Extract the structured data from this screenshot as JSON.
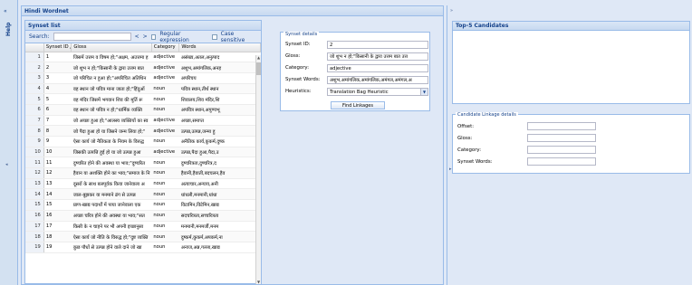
{
  "left_strip": {
    "collapse_symbol": "«",
    "help_label": "Help",
    "expand_symbol": "◂"
  },
  "main": {
    "title": "Hindi Wordnet",
    "synset_list": {
      "title": "Synset list",
      "search_label": "Search:",
      "search_value": "",
      "nav_prev": "<",
      "nav_next": ">",
      "regex_label": "Regular expression",
      "case_label": "Case sensitive",
      "columns": [
        "",
        "Synset ID ▲",
        "Gloss",
        "Category",
        "Words"
      ],
      "rows": [
        [
          "1",
          "1",
          "जिसमें उत्तम व विषम हो;\"अक्षम, अउत्तमा ह",
          "adjective",
          "असंख्य,अतल,अनुत्पाद"
        ],
        [
          "2",
          "2",
          "जो शुभ न हो;\"किसानी के द्वारा उत्तम बात",
          "adjective",
          "अशुभ,अमांगलिक,अनह"
        ],
        [
          "3",
          "3",
          "जो परिचित न हुआ हो;\"अपरिचित अतिथिन",
          "adjective",
          "अपरिचय"
        ],
        [
          "4",
          "4",
          "वह स्थान जो पवित्र माना जाता हो;\"हिंदुओं",
          "noun",
          "पवित्र स्थान,तीर्थ स्थान"
        ],
        [
          "5",
          "5",
          "वह मंदिर जिसमें भगवान शिव की मूर्ति रू",
          "noun",
          "शिवालय,शिव मंदिर,शि"
        ],
        [
          "6",
          "6",
          "वह स्थान जो पवित्र न हो;\"धार्मिक व्यक्ति",
          "noun",
          "अपवित्र स्थान,अपुण्यभू"
        ],
        [
          "7",
          "7",
          "जो अच्छा हुआ हो;\"आलस्य व्यक्तियों का स्व",
          "adjective",
          "अच्छा,समाप्त"
        ],
        [
          "8",
          "8",
          "जो पैदा हुआ हो या जिसने जन्म लिया हो;\"",
          "adjective",
          "उत्पन्न,उत्पन्न,जन्मा हु"
        ],
        [
          "9",
          "9",
          "ऐसा कार्य जो नैतिकता के नियम के विरुद्ध",
          "noun",
          "अनैतिक कार्य,कुकर्म,दुष्क"
        ],
        [
          "10",
          "10",
          "जिसकी उत्पत्ति हुई हो या जो उत्पन्न हुआ",
          "adjective",
          "उत्पन्न,पैदा हुआ,पैदा,उ"
        ],
        [
          "11",
          "11",
          "दुष्चरित होने की अवस्था या भाव;\"दुष्चरित",
          "noun",
          "दुष्चरित्रता,दुष्चरित्र,द"
        ],
        [
          "12",
          "12",
          "हैवान या अशक्ति होने का भाव;\"समाज के नि",
          "noun",
          "हैवानी,हैवाती,बदचलन,हैव"
        ],
        [
          "13",
          "13",
          "दूसरों के साथ बलपूर्वक किया जानेवाला अ",
          "noun",
          "अत्याचार,अन्याय,अनी"
        ],
        [
          "14",
          "14",
          "जाल-बुझकर या मनमाने ढंग से उत्पन्न",
          "noun",
          "धांधली,मनमानी,धांधा"
        ],
        [
          "15",
          "15",
          "प्राण-खाद्य पदार्थों में पाया जानेवाला एक",
          "noun",
          "विटामिन,विटेमिन,खाद्य"
        ],
        [
          "16",
          "16",
          "अच्छा चरित्र होने की अवस्था या भाव;\"सत",
          "noun",
          "सदचरित्रता,सच्चरित्रता"
        ],
        [
          "17",
          "17",
          "किसी के न चाहने पर भी अपनी इच्छानुसा",
          "noun",
          "मनमानी,मनमर्जी,मनम"
        ],
        [
          "18",
          "18",
          "ऐसा कार्य जो नीति के विरुद्ध हो;\"दुष्ट व्यक्ति",
          "noun",
          "दुष्कर्म,कुकर्म,अपकर्म,ना"
        ],
        [
          "19",
          "19",
          "कुछ पौधों से उत्पन्न होने वाले दाने जो खा",
          "noun",
          "अनाज,अन्न,गल्ला,खाद्य"
        ]
      ]
    },
    "synset_details": {
      "legend": "Synset details",
      "fields": [
        {
          "label": "Synset ID:",
          "value": "2"
        },
        {
          "label": "Gloss:",
          "value": "जो शुभ न हो;\"किसानी के द्वारा उत्तम बात उत्त"
        },
        {
          "label": "Category:",
          "value": "adjective"
        },
        {
          "label": "Synset Words:",
          "value": "अशुभ,अमांगलिक,अमांगलिक,अमंगल,अमंगल,अ"
        }
      ],
      "heuristics_label": "Heuristics:",
      "heuristics_value": "Translation Bag Heuristic",
      "find_button": "Find Linkages"
    }
  },
  "right": {
    "collapse_symbol": "»",
    "expand_symbol": "▸",
    "top5_title": "Top-5 Candidates",
    "linkage_legend": "Candidate Linkage details",
    "linkage_fields": [
      {
        "label": "Offset:",
        "value": ""
      },
      {
        "label": "Gloss:",
        "value": ""
      },
      {
        "label": "Category:",
        "value": ""
      },
      {
        "label": "Synset Words:",
        "value": ""
      }
    ]
  }
}
